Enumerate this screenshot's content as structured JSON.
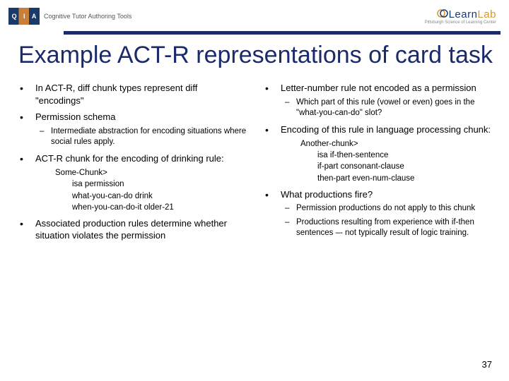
{
  "header": {
    "logo_left_letters": "QIA",
    "ctat": "Cognitive Tutor Authoring Tools",
    "learnlab_part1": "Learn",
    "learnlab_part2": "Lab",
    "learnlab_sub": "Pittsburgh Science of Learning Center"
  },
  "title": "Example ACT-R representations of card task",
  "left": {
    "b1": "In ACT-R, diff chunk types represent diff \"encodings\"",
    "b2": "Permission schema",
    "b2_sub1": "Intermediate abstraction for encoding situations where social rules apply.",
    "b3": "ACT-R chunk for the encoding of drinking rule:",
    "code_l1": "Some-Chunk>",
    "code_l2": "isa permission",
    "code_l3": "what-you-can-do  drink",
    "code_l4": "when-you-can-do-it  older-21",
    "b4": "Associated production rules determine whether situation violates the permission"
  },
  "right": {
    "b1": "Letter-number rule not encoded as a permission",
    "b1_sub1": "Which part of this rule (vowel or even) goes in the \"what-you-can-do\" slot?",
    "b2": "Encoding of this rule in language processing chunk:",
    "code_l1": "Another-chunk>",
    "code_l2": "isa if-then-sentence",
    "code_l3": "if-part consonant-clause",
    "code_l4": "then-part even-num-clause",
    "b3": "What productions fire?",
    "b3_sub1": "Permission productions do not apply to this chunk",
    "b3_sub2": "Productions resulting from experience with if-then sentences –- not typically result of logic training."
  },
  "page_number": "37"
}
